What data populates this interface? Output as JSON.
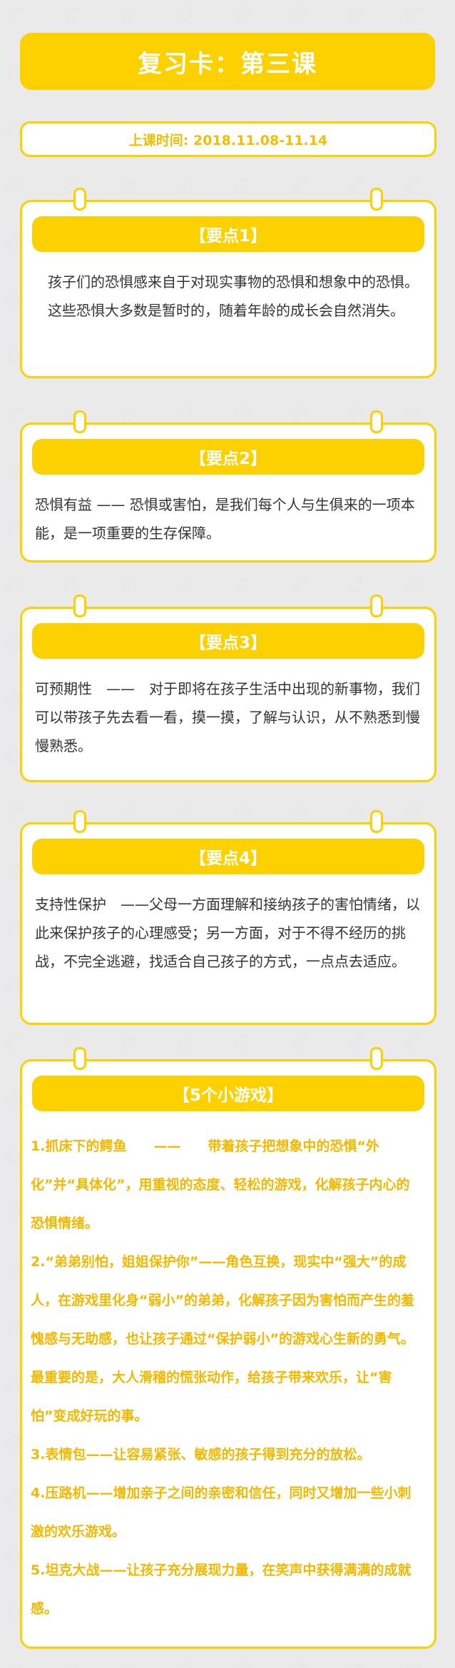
{
  "title": "复习卡：第三课",
  "date": "上课时间: 2018.11.08-11.14",
  "cards": [
    {
      "heading": "【要点1】",
      "text": "孩子们的恐惧感来自于对现实事物的恐惧和想象中的恐惧。这些恐惧大多数是暂时的，随着年龄的成长会自然消失。"
    },
    {
      "heading": "【要点2】",
      "text": "恐惧有益 —— 恐惧或害怕，是我们每个人与生俱来的一项本能，是一项重要的生存保障。"
    },
    {
      "heading": "【要点3】",
      "text": "可预期性　——　对于即将在孩子生活中出现的新事物，我们可以带孩子先去看一看，摸一摸，了解与认识，从不熟悉到慢慢熟悉。"
    },
    {
      "heading": "【要点4】",
      "text": "支持性保护　——父母一方面理解和接纳孩子的害怕情绪，以此来保护孩子的心理感受；另一方面，对于不得不经历的挑战，不完全逃避，找适合自己孩子的方式，一点点去适应。"
    }
  ],
  "games": {
    "heading": "【5个小游戏】",
    "items": [
      "1.抓床下的鳄鱼　　——　　带着孩子把想象中的恐惧“外化”并“具体化”，用重视的态度、轻松的游戏，化解孩子内心的恐惧情绪。",
      "2.“弟弟别怕，姐姐保护你”——角色互换，现实中“强大”的成人，在游戏里化身“弱小”的弟弟，化解孩子因为害怕而产生的羞愧感与无助感，也让孩子通过“保护弱小”的游戏心生新的勇气。最重要的是，大人滑稽的慌张动作，给孩子带来欢乐，让“害怕”变成好玩的事。",
      "3.表情包——让容易紧张、敏感的孩子得到充分的放松。",
      "4.压路机——增加亲子之间的亲密和信任，同时又增加一些小刺激的欢乐游戏。",
      "5.坦克大战——让孩子充分展现力量，在笑声中获得满满的成就感。"
    ]
  }
}
